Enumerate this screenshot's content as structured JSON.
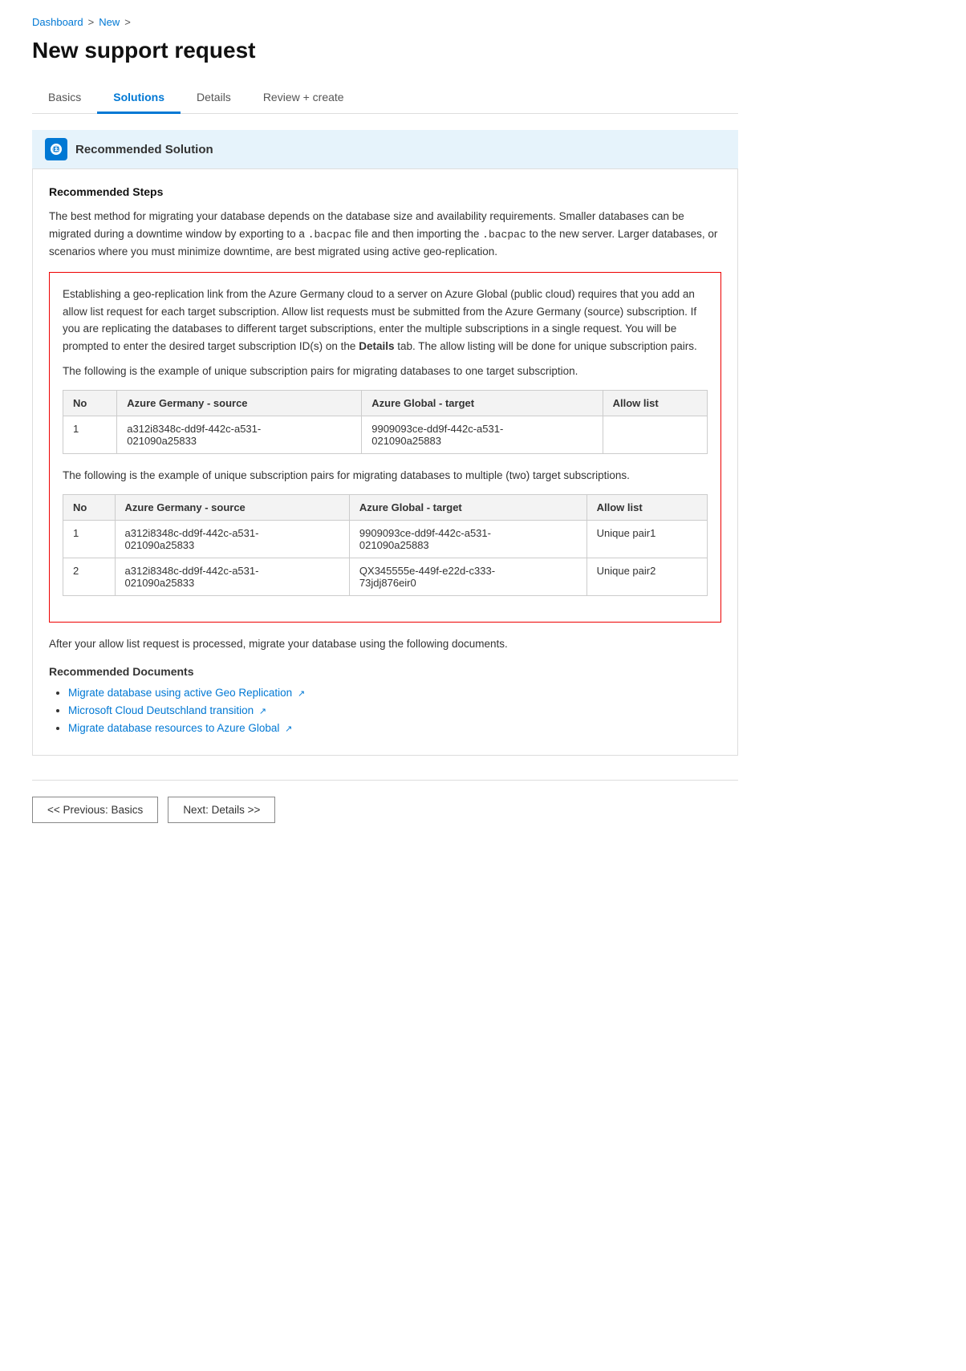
{
  "breadcrumb": {
    "items": [
      "Dashboard",
      "New"
    ]
  },
  "page_title": "New support request",
  "tabs": [
    {
      "label": "Basics",
      "active": false
    },
    {
      "label": "Solutions",
      "active": true
    },
    {
      "label": "Details",
      "active": false
    },
    {
      "label": "Review + create",
      "active": false
    }
  ],
  "solution_header": {
    "label": "Recommended Solution"
  },
  "recommended_steps": {
    "title": "Recommended Steps",
    "intro_paragraph": "The best method for migrating your database depends on the database size and availability requirements. Smaller databases can be migrated during a downtime window by exporting to a .bacpac file and then importing the .bacpac to the new server. Larger databases, or scenarios where you must minimize downtime, are best migrated using active geo-replication.",
    "highlight_para1": "Establishing a geo-replication link from the Azure Germany cloud to a server on Azure Global (public cloud) requires that you add an allow list request for each target subscription. Allow list requests must be submitted from the Azure Germany (source) subscription. If you are replicating the databases to different target subscriptions, enter the multiple subscriptions in a single request. You will be prompted to enter the desired target subscription ID(s) on the",
    "highlight_para1_bold": "Details",
    "highlight_para1_end": "tab. The allow listing will be done for unique subscription pairs.",
    "table1_intro": "The following is the example of unique subscription pairs for migrating databases to one target subscription.",
    "table1_headers": [
      "No",
      "Azure Germany - source",
      "Azure Global - target",
      "Allow list"
    ],
    "table1_rows": [
      {
        "no": "1",
        "source": "a312i8348c-dd9f-442c-a531-\n021090a25833",
        "target": "9909093ce-dd9f-442c-a531-\n021090a25883",
        "allow": ""
      }
    ],
    "table2_intro": "The following is the example of unique subscription pairs for migrating databases to multiple (two) target subscriptions.",
    "table2_headers": [
      "No",
      "Azure Germany - source",
      "Azure Global - target",
      "Allow list"
    ],
    "table2_rows": [
      {
        "no": "1",
        "source": "a312i8348c-dd9f-442c-a531-\n021090a25833",
        "target": "9909093ce-dd9f-442c-a531-\n021090a25883",
        "allow": "Unique pair1"
      },
      {
        "no": "2",
        "source": "a312i8348c-dd9f-442c-a531-\n021090a25833",
        "target": "QX345555e-449f-e22d-c333-\n73jdj876eir0",
        "allow": "Unique pair2"
      }
    ],
    "after_box": "After your allow list request is processed, migrate your database using the following documents.",
    "rec_docs_title": "Recommended Documents",
    "doc_links": [
      {
        "label": "Migrate database using active Geo Replication",
        "url": "#"
      },
      {
        "label": "Microsoft Cloud Deutschland transition",
        "url": "#"
      },
      {
        "label": "Migrate database resources to Azure Global",
        "url": "#"
      }
    ]
  },
  "footer": {
    "prev_label": "<< Previous: Basics",
    "next_label": "Next: Details >>"
  }
}
